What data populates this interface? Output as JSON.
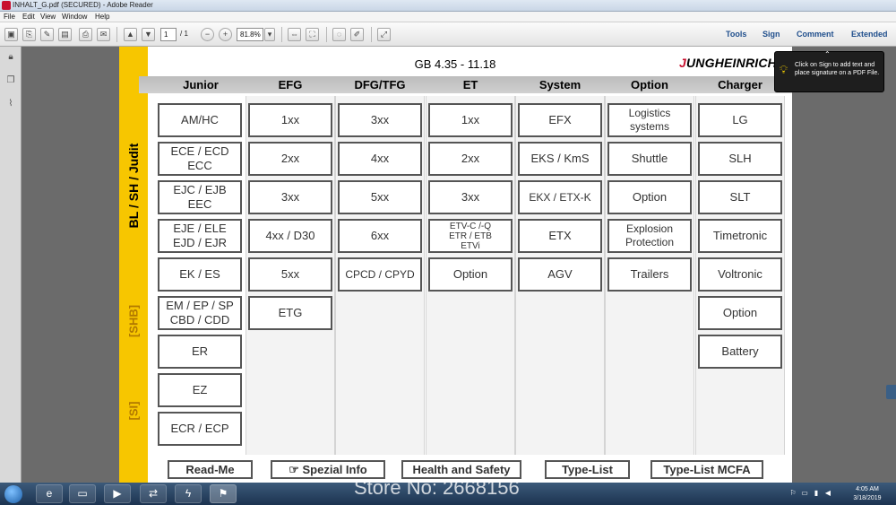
{
  "window": {
    "title": "INHALT_G.pdf (SECURED) - Adobe Reader"
  },
  "menu": [
    "File",
    "Edit",
    "View",
    "Window",
    "Help"
  ],
  "toolbar": {
    "page_current": "1",
    "page_total": "/ 1",
    "zoom": "81.8%",
    "links": [
      "Tools",
      "Sign",
      "Comment",
      "Extended"
    ]
  },
  "tooltip": {
    "text": "Click on Sign to add text and place signature on a PDF File."
  },
  "document": {
    "title": "GB 4.35  -  11.18",
    "logo_first": "J",
    "logo_rest": "UNGHEINRICH",
    "side_labels": [
      "BL / SH / Judit",
      "[SHB]",
      "[SI]"
    ],
    "columns": [
      {
        "name": "Junior",
        "items": [
          "AM/HC",
          "ECE / ECD\nECC",
          "EJC / EJB\nEEC",
          "EJE / ELE\nEJD / EJR",
          "EK / ES",
          "EM / EP / SP\nCBD / CDD",
          "ER",
          "EZ",
          "ECR / ECP"
        ]
      },
      {
        "name": "EFG",
        "items": [
          "1xx",
          "2xx",
          "3xx",
          "4xx / D30",
          "5xx",
          "ETG"
        ]
      },
      {
        "name": "DFG/TFG",
        "items": [
          "3xx",
          "4xx",
          "5xx",
          "6xx",
          "CPCD / CPYD"
        ]
      },
      {
        "name": "ET",
        "items": [
          "1xx",
          "2xx",
          "3xx",
          "ETV-C /-Q\nETR / ETB\nETVi",
          "Option"
        ]
      },
      {
        "name": "System",
        "items": [
          "EFX",
          "EKS / KmS",
          "EKX / ETX-K",
          "ETX",
          "AGV"
        ]
      },
      {
        "name": "Option",
        "items": [
          "Logistics\nsystems",
          "Shuttle",
          "Option",
          "Explosion\nProtection",
          "Trailers"
        ]
      },
      {
        "name": "Charger",
        "items": [
          "LG",
          "SLH",
          "SLT",
          "Timetronic",
          "Voltronic",
          "Option",
          "Battery"
        ]
      }
    ],
    "bottom_buttons": [
      "Read-Me",
      "☞ Spezial Info",
      "Health and Safety",
      "Type-List",
      "Type-List MCFA"
    ]
  },
  "watermark": "Store No: 2668156",
  "clock": {
    "time": "4:05 AM",
    "date": "3/18/2019"
  },
  "colors": {
    "accent_yellow": "#f7c600",
    "logo_red": "#c8102e",
    "header_band": "#c4c4c4"
  }
}
